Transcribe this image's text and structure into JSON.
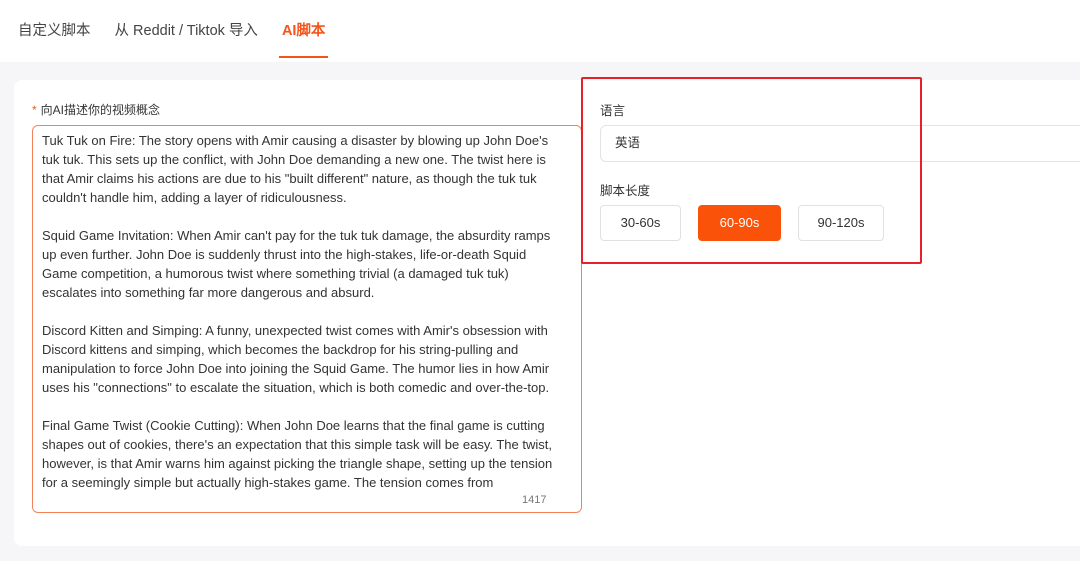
{
  "tabs": [
    {
      "label": "自定义脚本",
      "active": false
    },
    {
      "label": "从 Reddit / Tiktok 导入",
      "active": false
    },
    {
      "label": "AI脚本",
      "active": true
    }
  ],
  "concept": {
    "required_mark": "*",
    "label": "向AI描述你的视频概念",
    "text": "Tuk Tuk on Fire: The story opens with Amir causing a disaster by blowing up John Doe's tuk tuk. This sets up the conflict, with John Doe demanding a new one. The twist here is that Amir claims his actions are due to his \"built different\" nature, as though the tuk tuk couldn't handle him, adding a layer of ridiculousness.\n\nSquid Game Invitation: When Amir can't pay for the tuk tuk damage, the absurdity ramps up even further. John Doe is suddenly thrust into the high-stakes, life-or-death Squid Game competition, a humorous twist where something trivial (a damaged tuk tuk) escalates into something far more dangerous and absurd.\n\nDiscord Kitten and Simping: A funny, unexpected twist comes with Amir's obsession with Discord kittens and simping, which becomes the backdrop for his string-pulling and manipulation to force John Doe into joining the Squid Game. The humor lies in how Amir uses his \"connections\" to escalate the situation, which is both comedic and over-the-top.\n\nFinal Game Twist (Cookie Cutting): When John Doe learns that the final game is cutting shapes out of cookies, there's an expectation that this simple task will be easy. The twist, however, is that Amir warns him against picking the triangle shape, setting up the tension for a seemingly simple but actually high-stakes game. The tension comes from",
    "char_count": "1417"
  },
  "language": {
    "label": "语言",
    "value": "英语"
  },
  "script_length": {
    "label": "脚本长度",
    "options": [
      {
        "label": "30-60s",
        "active": false
      },
      {
        "label": "60-90s",
        "active": true
      },
      {
        "label": "90-120s",
        "active": false
      }
    ]
  },
  "colors": {
    "accent": "#fa5208",
    "highlight": "#e8202a"
  }
}
